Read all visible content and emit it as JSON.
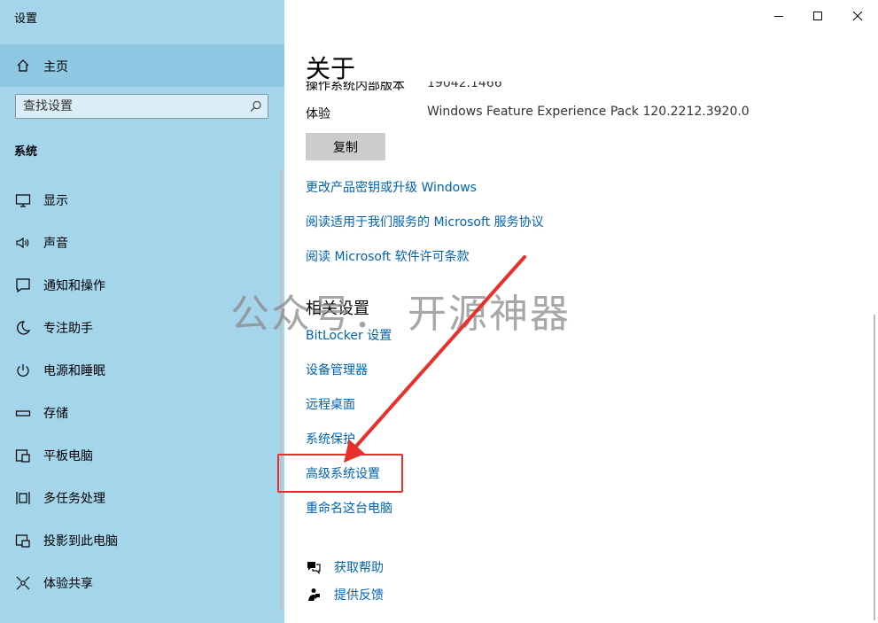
{
  "window": {
    "title": "设置",
    "controls": [
      "minimize",
      "maximize",
      "close"
    ]
  },
  "sidebar": {
    "home_label": "主页",
    "search_placeholder": "查找设置",
    "section_label": "系统",
    "items": [
      {
        "label": "显示",
        "icon": "display-icon"
      },
      {
        "label": "声音",
        "icon": "speaker-icon"
      },
      {
        "label": "通知和操作",
        "icon": "notification-icon"
      },
      {
        "label": "专注助手",
        "icon": "moon-icon"
      },
      {
        "label": "电源和睡眠",
        "icon": "power-icon"
      },
      {
        "label": "存储",
        "icon": "storage-icon"
      },
      {
        "label": "平板电脑",
        "icon": "tablet-icon"
      },
      {
        "label": "多任务处理",
        "icon": "multitask-icon"
      },
      {
        "label": "投影到此电脑",
        "icon": "project-icon"
      },
      {
        "label": "体验共享",
        "icon": "share-icon"
      }
    ]
  },
  "content": {
    "title": "关于",
    "specs": [
      {
        "key": "操作系统内部版本",
        "value": "19042.1466"
      },
      {
        "key": "体验",
        "value": "Windows Feature Experience Pack 120.2212.3920.0"
      }
    ],
    "copy_label": "复制",
    "links": [
      "更改产品密钥或升级 Windows",
      "阅读适用于我们服务的 Microsoft 服务协议",
      "阅读 Microsoft 软件许可条款"
    ],
    "related_title": "相关设置",
    "related_links": [
      "BitLocker 设置",
      "设备管理器",
      "远程桌面",
      "系统保护",
      "高级系统设置",
      "重命名这台电脑"
    ],
    "help": [
      {
        "label": "获取帮助",
        "icon": "help-chat-icon"
      },
      {
        "label": "提供反馈",
        "icon": "feedback-icon"
      }
    ]
  },
  "overlay": {
    "watermark": "公众号： 开源神器",
    "highlight_color": "#e8302a"
  },
  "colors": {
    "sidebar_bg": "#a5d5ea",
    "link": "#0063b1"
  }
}
